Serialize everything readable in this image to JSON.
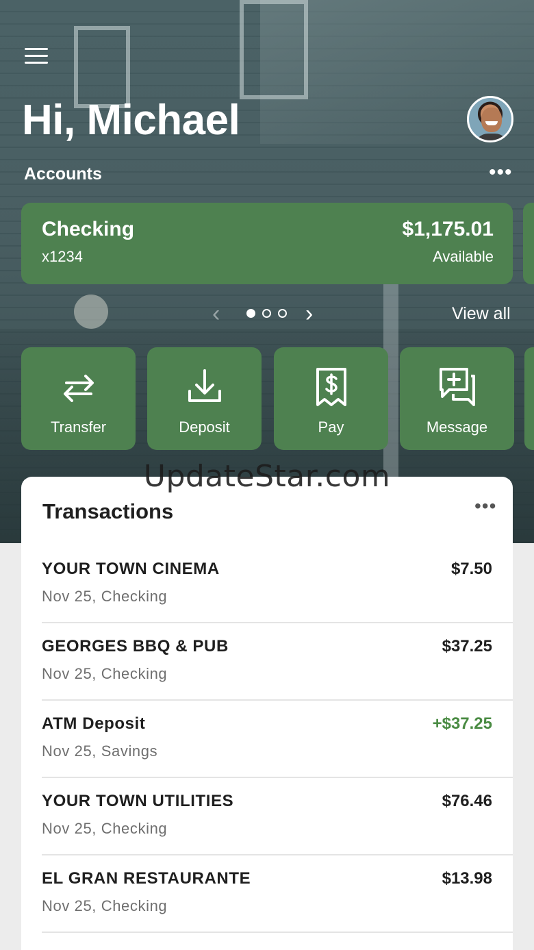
{
  "header": {
    "greeting": "Hi, Michael",
    "menu_icon": "hamburger-menu-icon",
    "avatar_icon": "user-avatar"
  },
  "accounts": {
    "label": "Accounts",
    "more_icon": "more-horizontal-icon",
    "card": {
      "name": "Checking",
      "number": "x1234",
      "balance": "$1,175.01",
      "balance_label": "Available"
    },
    "pager": {
      "pages": 3,
      "active": 1,
      "prev_glyph": "‹",
      "next_glyph": "›"
    },
    "view_all": "View all"
  },
  "actions": [
    {
      "label": "Transfer",
      "icon": "transfer-arrows-icon"
    },
    {
      "label": "Deposit",
      "icon": "download-tray-icon"
    },
    {
      "label": "Pay",
      "icon": "dollar-receipt-icon"
    },
    {
      "label": "Message",
      "icon": "message-plus-icon"
    }
  ],
  "watermark": "UpdateStar.com",
  "transactions": {
    "title": "Transactions",
    "more_icon": "more-horizontal-icon",
    "items": [
      {
        "name": "YOUR TOWN CINEMA",
        "sub": "Nov 25, Checking",
        "amount": "$7.50",
        "positive": false
      },
      {
        "name": "GEORGES BBQ & PUB",
        "sub": "Nov 25, Checking",
        "amount": "$37.25",
        "positive": false
      },
      {
        "name": "ATM Deposit",
        "sub": "Nov 25, Savings",
        "amount": "+$37.25",
        "positive": true
      },
      {
        "name": "YOUR TOWN UTILITIES",
        "sub": "Nov 25, Checking",
        "amount": "$76.46",
        "positive": false
      },
      {
        "name": "EL GRAN RESTAURANTE",
        "sub": "Nov 25, Checking",
        "amount": "$13.98",
        "positive": false
      }
    ]
  },
  "colors": {
    "card_green": "#4e8150",
    "positive_amount": "#4a8b43"
  }
}
